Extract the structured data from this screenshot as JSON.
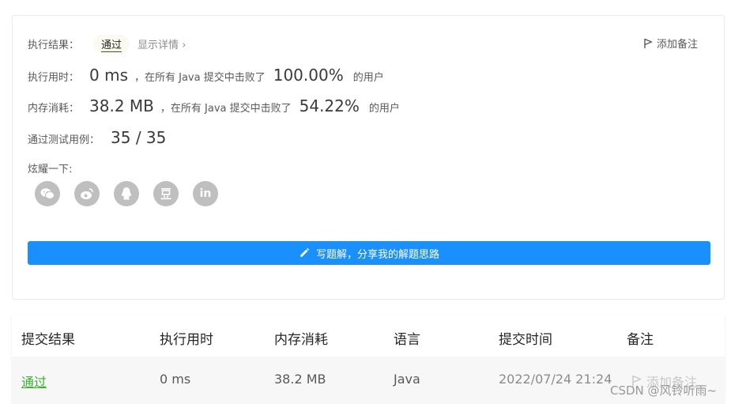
{
  "result": {
    "label": "执行结果：",
    "status": "通过",
    "details_link": "显示详情",
    "details_chevron": "›",
    "add_note": "添加备注"
  },
  "runtime": {
    "label": "执行用时：",
    "value": "0 ms",
    "middle": "，在所有 Java 提交中击败了",
    "percent": "100.00%",
    "suffix": "的用户"
  },
  "memory": {
    "label": "内存消耗：",
    "value": "38.2 MB",
    "middle": "，在所有 Java 提交中击败了",
    "percent": "54.22%",
    "suffix": "的用户"
  },
  "tests": {
    "label": "通过测试用例：",
    "value": "35 / 35"
  },
  "share": {
    "label": "炫耀一下:",
    "icons": [
      "wechat-icon",
      "weibo-icon",
      "qq-icon",
      "douban-icon",
      "linkedin-icon"
    ],
    "linkedin_text": "in"
  },
  "write_solution": {
    "label": "写题解，分享我的解题思路"
  },
  "table": {
    "headers": [
      "提交结果",
      "执行用时",
      "内存消耗",
      "语言",
      "提交时间",
      "备注"
    ],
    "rows": [
      {
        "result": "通过",
        "runtime": "0 ms",
        "memory": "38.2 MB",
        "language": "Java",
        "time": "2022/07/24 21:24",
        "note": "添加备注"
      }
    ]
  },
  "watermark": "CSDN @风铃听雨~",
  "colors": {
    "primary_button": "#1a90ff",
    "pass_green": "#3cb030",
    "icon_gray": "#bfbfbf"
  }
}
